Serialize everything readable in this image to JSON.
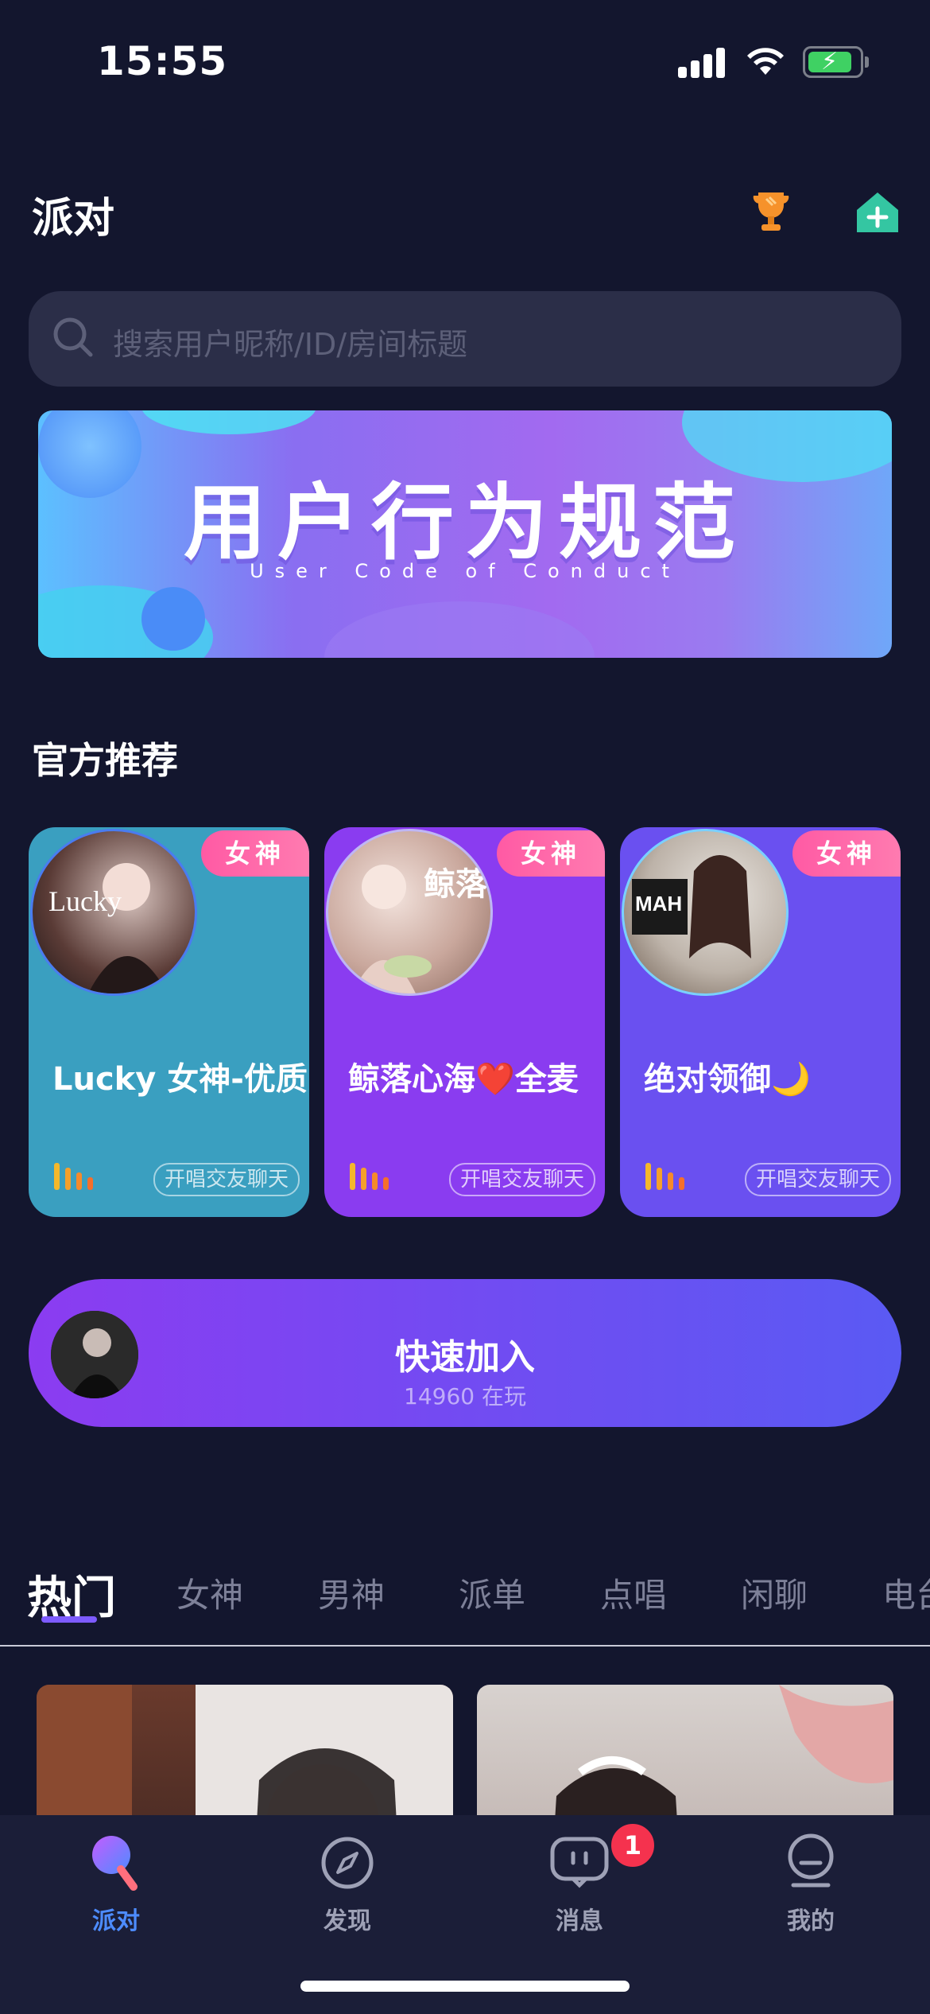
{
  "status_bar": {
    "time": "15:55"
  },
  "header": {
    "title": "派对"
  },
  "search": {
    "placeholder": "搜索用户昵称/ID/房间标题"
  },
  "banner": {
    "title": "用户行为规范",
    "subtitle": "User Code of Conduct"
  },
  "official": {
    "section_title": "官方推荐",
    "cards": [
      {
        "tag": "女神",
        "name": "Lucky 女神-优质",
        "pill": "开唱交友聊天",
        "avatar_text": "Lucky"
      },
      {
        "tag": "女神",
        "name": "鲸落心海❤️全麦",
        "pill": "开唱交友聊天",
        "avatar_text": "鲸落"
      },
      {
        "tag": "女神",
        "name": "绝对领御🌙",
        "pill": "开唱交友聊天",
        "avatar_text": "MAH"
      }
    ]
  },
  "quick_join": {
    "label": "快速加入",
    "count_text": "14960 在玩"
  },
  "tabs": [
    "热门",
    "女神",
    "男神",
    "派单",
    "点唱",
    "闲聊",
    "电台"
  ],
  "bottom_nav": [
    {
      "label": "派对",
      "icon": "party-icon",
      "active": true
    },
    {
      "label": "发现",
      "icon": "compass-icon"
    },
    {
      "label": "消息",
      "icon": "message-icon",
      "badge": "1"
    },
    {
      "label": "我的",
      "icon": "profile-icon"
    }
  ],
  "colors": {
    "background": "#13162e",
    "accent": "#4d8cff",
    "tag_pink": "#ff5aa4",
    "card_teal": "#3a9fc0",
    "card_purple": "#8a3cf0",
    "card_indigo": "#6a50f0"
  }
}
